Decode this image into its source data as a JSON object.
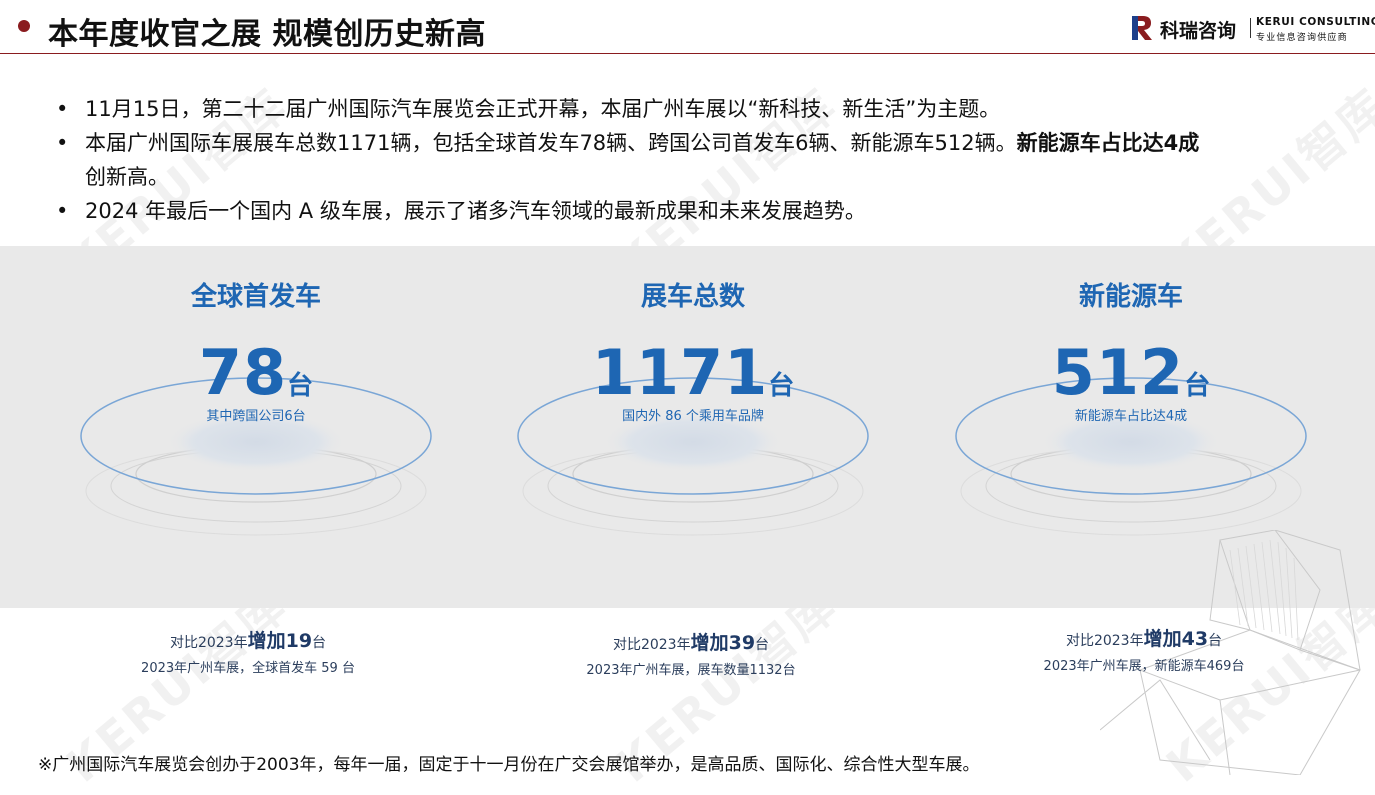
{
  "header": {
    "title": "本年度收官之展 规模创历史新高",
    "logo": {
      "cn": "科瑞咨询",
      "en": "KERUI CONSULTING",
      "en_sub": "专业信息咨询供应商"
    }
  },
  "bullets": [
    {
      "marker": "•",
      "text": "11月15日，第二十二届广州国际汽车展览会正式开幕，本届广州车展以“新科技、新生活”为主题。"
    },
    {
      "marker": "•",
      "text": "本届广州国际车展展车总数1171辆，包括全球首发车78辆、跨国公司首发车6辆、新能源车512辆。",
      "bold": "新能源车占比达4成",
      "text2": "创新高。"
    },
    {
      "marker": "•",
      "text": "2024 年最后一个国内 A 级车展，展示了诸多汽车领域的最新成果和未来发展趋势。"
    }
  ],
  "stats": [
    {
      "title": "全球首发车",
      "number": "78",
      "unit": "台",
      "sub": "其中跨国公司6台",
      "compare_prefix": "对比2023年",
      "compare_inc": "增加19",
      "compare_unit": "台",
      "compare_note": "2023年广州车展，全球首发车 59 台"
    },
    {
      "title": "展车总数",
      "number": "1171",
      "unit": "台",
      "sub": "国内外 86 个乘用车品牌",
      "compare_prefix": "对比2023年",
      "compare_inc": "增加39",
      "compare_unit": "台",
      "compare_note": "2023年广州车展，展车数量1132台"
    },
    {
      "title": "新能源车",
      "number": "512",
      "unit": "台",
      "sub": "新能源车占比达4成",
      "compare_prefix": "对比2023年",
      "compare_inc": "增加43",
      "compare_unit": "台",
      "compare_note": "2023年广州车展，新能源车469台"
    }
  ],
  "footnote": "※广州国际汽车展览会创办于2003年，每年一届，固定于十一月份在广交会展馆举办，是高品质、国际化、综合性大型车展。",
  "watermark": "KERUI智库",
  "colors": {
    "accent_blue": "#1e66b3",
    "brand_red": "#8a1c1f",
    "band_gray": "#e9e9e9"
  }
}
